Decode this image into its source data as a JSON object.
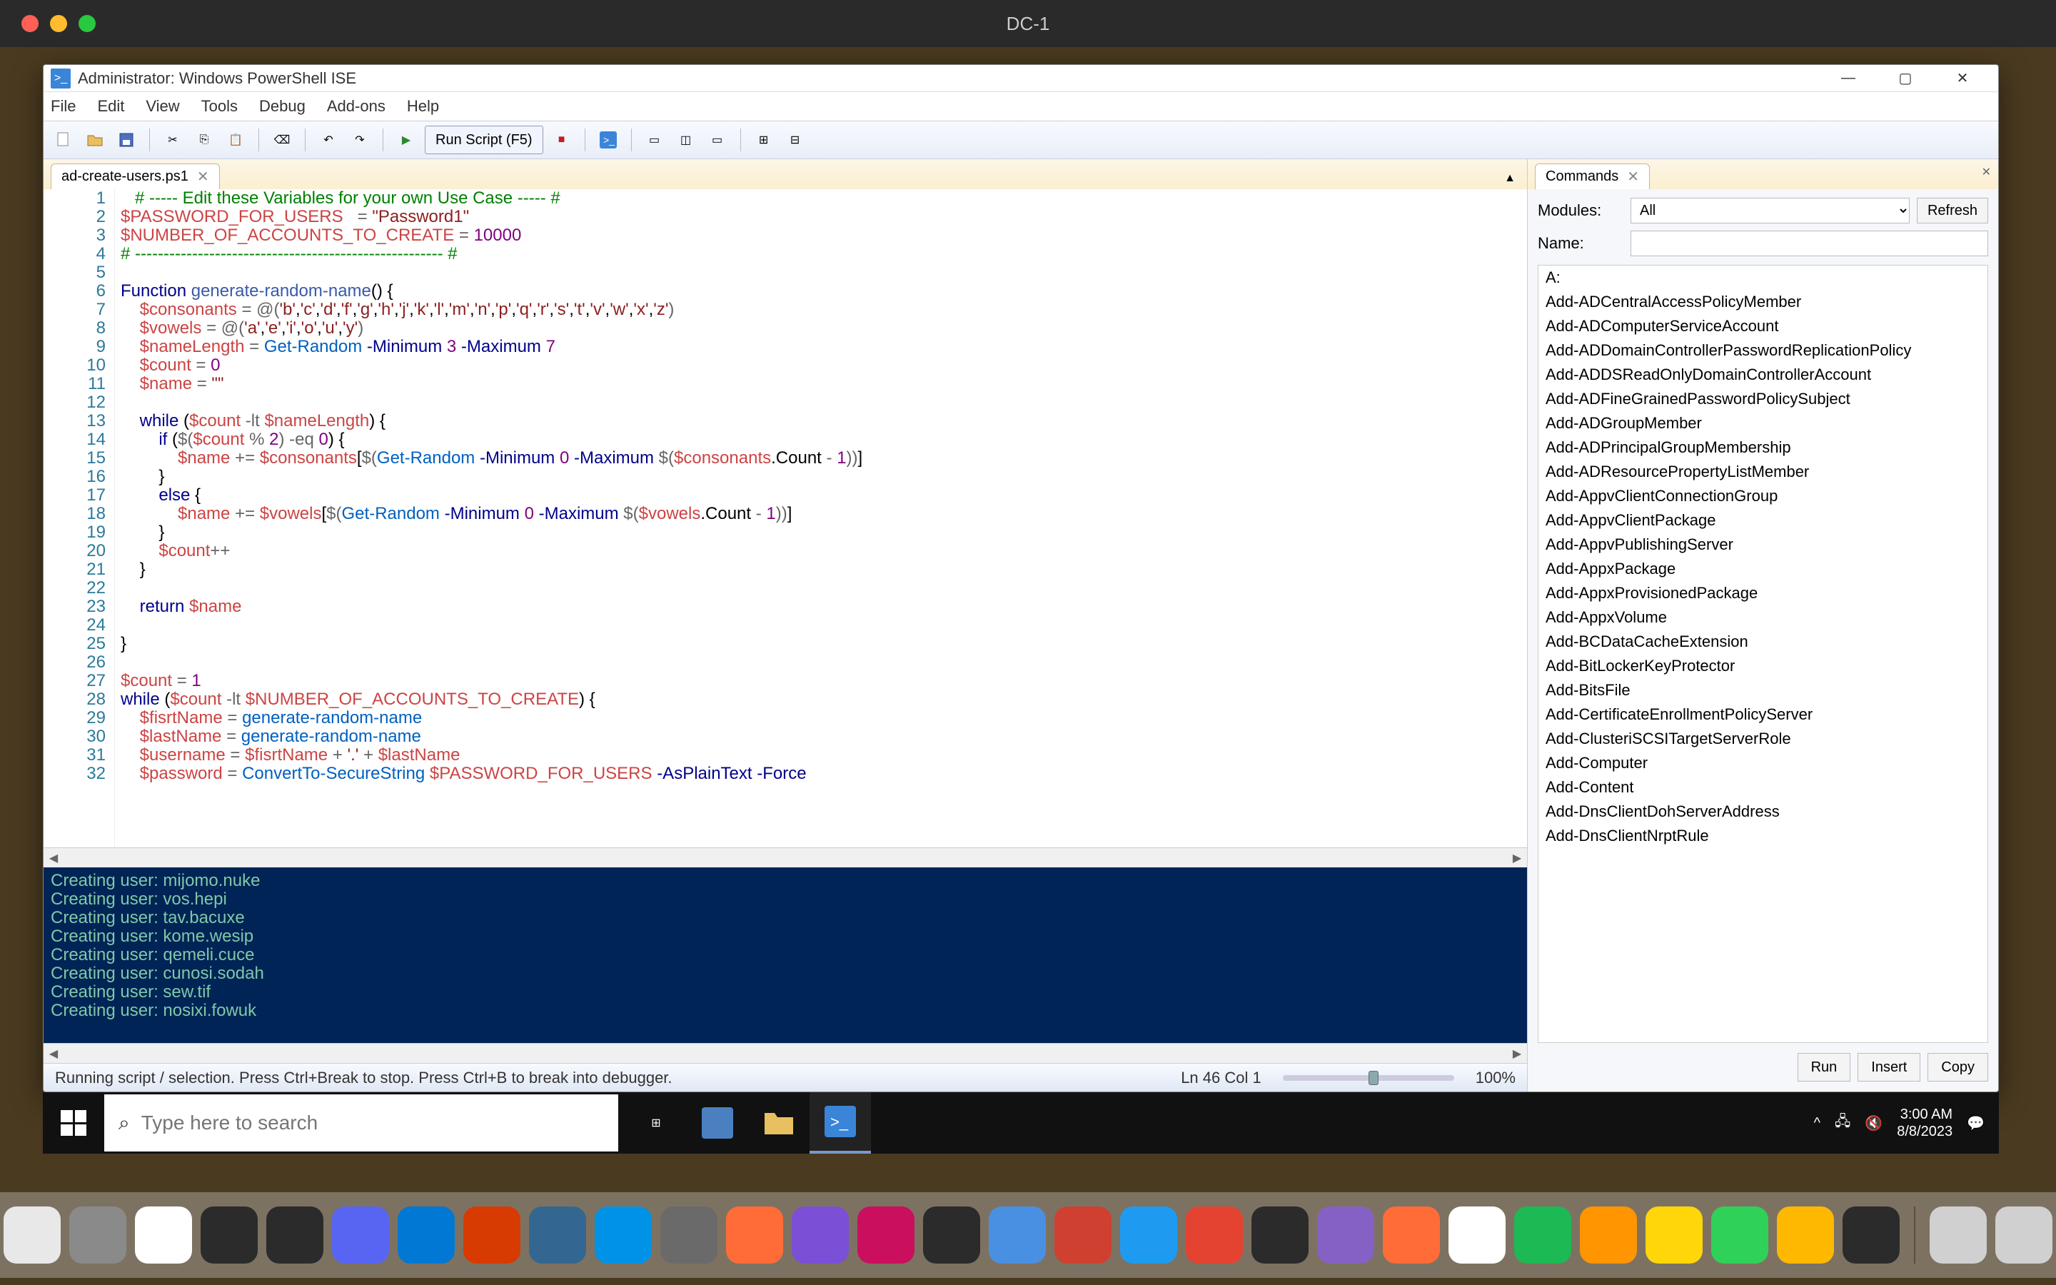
{
  "mac": {
    "window_title": "DC-1",
    "menubar_right": {
      "time": "3:00 AM",
      "date": "8/8/2023"
    }
  },
  "ise": {
    "titlebar": "Administrator: Windows PowerShell ISE",
    "menus": [
      "File",
      "Edit",
      "View",
      "Tools",
      "Debug",
      "Add-ons",
      "Help"
    ],
    "run_button": "Run Script (F5)",
    "tab": {
      "label": "ad-create-users.ps1"
    },
    "status": {
      "left": "Running script / selection.  Press Ctrl+Break to stop.  Press Ctrl+B to break into debugger.",
      "pos": "Ln 46  Col 1",
      "zoom": "100%"
    },
    "code_lines": [
      {
        "n": 1,
        "html": "   <span class='c-comment'># ----- Edit these Variables for your own Use Case ----- #</span>"
      },
      {
        "n": 2,
        "html": "<span class='c-var'>$PASSWORD_FOR_USERS</span>   <span class='c-op'>=</span> <span class='c-string'>\"Password1\"</span>"
      },
      {
        "n": 3,
        "html": "<span class='c-var'>$NUMBER_OF_ACCOUNTS_TO_CREATE</span> <span class='c-op'>=</span> <span class='c-num'>10000</span>"
      },
      {
        "n": 4,
        "html": "<span class='c-comment'># ------------------------------------------------------ #</span>"
      },
      {
        "n": 5,
        "html": ""
      },
      {
        "n": 6,
        "html": "<span class='c-key'>Function</span> <span class='c-func'>generate-random-name</span>() {"
      },
      {
        "n": 7,
        "html": "    <span class='c-var'>$consonants</span> <span class='c-op'>=</span> <span class='c-op'>@(</span><span class='c-string'>'b'</span>,<span class='c-string'>'c'</span>,<span class='c-string'>'d'</span>,<span class='c-string'>'f'</span>,<span class='c-string'>'g'</span>,<span class='c-string'>'h'</span>,<span class='c-string'>'j'</span>,<span class='c-string'>'k'</span>,<span class='c-string'>'l'</span>,<span class='c-string'>'m'</span>,<span class='c-string'>'n'</span>,<span class='c-string'>'p'</span>,<span class='c-string'>'q'</span>,<span class='c-string'>'r'</span>,<span class='c-string'>'s'</span>,<span class='c-string'>'t'</span>,<span class='c-string'>'v'</span>,<span class='c-string'>'w'</span>,<span class='c-string'>'x'</span>,<span class='c-string'>'z'</span><span class='c-op'>)</span>"
      },
      {
        "n": 8,
        "html": "    <span class='c-var'>$vowels</span> <span class='c-op'>=</span> <span class='c-op'>@(</span><span class='c-string'>'a'</span>,<span class='c-string'>'e'</span>,<span class='c-string'>'i'</span>,<span class='c-string'>'o'</span>,<span class='c-string'>'u'</span>,<span class='c-string'>'y'</span><span class='c-op'>)</span>"
      },
      {
        "n": 9,
        "html": "    <span class='c-var'>$nameLength</span> <span class='c-op'>=</span> <span class='c-cmd'>Get-Random</span> <span class='c-key'>-Minimum</span> <span class='c-num'>3</span> <span class='c-key'>-Maximum</span> <span class='c-num'>7</span>"
      },
      {
        "n": 10,
        "html": "    <span class='c-var'>$count</span> <span class='c-op'>=</span> <span class='c-num'>0</span>"
      },
      {
        "n": 11,
        "html": "    <span class='c-var'>$name</span> <span class='c-op'>=</span> <span class='c-string'>\"\"</span>"
      },
      {
        "n": 12,
        "html": ""
      },
      {
        "n": 13,
        "html": "    <span class='c-key'>while</span> (<span class='c-var'>$count</span> <span class='c-op'>-lt</span> <span class='c-var'>$nameLength</span>) {"
      },
      {
        "n": 14,
        "html": "        <span class='c-key'>if</span> (<span class='c-op'>$(</span><span class='c-var'>$count</span> <span class='c-op'>%</span> <span class='c-num'>2</span><span class='c-op'>)</span> <span class='c-op'>-eq</span> <span class='c-num'>0</span>) {"
      },
      {
        "n": 15,
        "html": "            <span class='c-var'>$name</span> <span class='c-op'>+=</span> <span class='c-var'>$consonants</span>[<span class='c-op'>$(</span><span class='c-cmd'>Get-Random</span> <span class='c-key'>-Minimum</span> <span class='c-num'>0</span> <span class='c-key'>-Maximum</span> <span class='c-op'>$(</span><span class='c-var'>$consonants</span>.Count <span class='c-op'>-</span> <span class='c-num'>1</span><span class='c-op'>))</span>]"
      },
      {
        "n": 16,
        "html": "        }"
      },
      {
        "n": 17,
        "html": "        <span class='c-key'>else</span> {"
      },
      {
        "n": 18,
        "html": "            <span class='c-var'>$name</span> <span class='c-op'>+=</span> <span class='c-var'>$vowels</span>[<span class='c-op'>$(</span><span class='c-cmd'>Get-Random</span> <span class='c-key'>-Minimum</span> <span class='c-num'>0</span> <span class='c-key'>-Maximum</span> <span class='c-op'>$(</span><span class='c-var'>$vowels</span>.Count <span class='c-op'>-</span> <span class='c-num'>1</span><span class='c-op'>))</span>]"
      },
      {
        "n": 19,
        "html": "        }"
      },
      {
        "n": 20,
        "html": "        <span class='c-var'>$count</span><span class='c-op'>++</span>"
      },
      {
        "n": 21,
        "html": "    }"
      },
      {
        "n": 22,
        "html": ""
      },
      {
        "n": 23,
        "html": "    <span class='c-key'>return</span> <span class='c-var'>$name</span>"
      },
      {
        "n": 24,
        "html": ""
      },
      {
        "n": 25,
        "html": "}"
      },
      {
        "n": 26,
        "html": ""
      },
      {
        "n": 27,
        "html": "<span class='c-var'>$count</span> <span class='c-op'>=</span> <span class='c-num'>1</span>"
      },
      {
        "n": 28,
        "html": "<span class='c-key'>while</span> (<span class='c-var'>$count</span> <span class='c-op'>-lt</span> <span class='c-var'>$NUMBER_OF_ACCOUNTS_TO_CREATE</span>) {"
      },
      {
        "n": 29,
        "html": "    <span class='c-var'>$fisrtName</span> <span class='c-op'>=</span> <span class='c-cmd'>generate-random-name</span>"
      },
      {
        "n": 30,
        "html": "    <span class='c-var'>$lastName</span> <span class='c-op'>=</span> <span class='c-cmd'>generate-random-name</span>"
      },
      {
        "n": 31,
        "html": "    <span class='c-var'>$username</span> <span class='c-op'>=</span> <span class='c-var'>$fisrtName</span> <span class='c-op'>+</span> <span class='c-string'>'.'</span> <span class='c-op'>+</span> <span class='c-var'>$lastName</span>"
      },
      {
        "n": 32,
        "html": "    <span class='c-var'>$password</span> <span class='c-op'>=</span> <span class='c-cmd'>ConvertTo-SecureString</span> <span class='c-var'>$PASSWORD_FOR_USERS</span> <span class='c-key'>-AsPlainText</span> <span class='c-key'>-Force</span>"
      }
    ],
    "console_lines": [
      "Creating user: mijomo.nuke",
      "Creating user: vos.hepi",
      "Creating user: tav.bacuxe",
      "Creating user: kome.wesip",
      "Creating user: qemeli.cuce",
      "Creating user: cunosi.sodah",
      "Creating user: sew.tif",
      "Creating user: nosixi.fowuk"
    ]
  },
  "commands_panel": {
    "title": "Commands",
    "modules_label": "Modules:",
    "modules_value": "All",
    "name_label": "Name:",
    "refresh": "Refresh",
    "actions": {
      "run": "Run",
      "insert": "Insert",
      "copy": "Copy"
    },
    "list": [
      "A:",
      "Add-ADCentralAccessPolicyMember",
      "Add-ADComputerServiceAccount",
      "Add-ADDomainControllerPasswordReplicationPolicy",
      "Add-ADDSReadOnlyDomainControllerAccount",
      "Add-ADFineGrainedPasswordPolicySubject",
      "Add-ADGroupMember",
      "Add-ADPrincipalGroupMembership",
      "Add-ADResourcePropertyListMember",
      "Add-AppvClientConnectionGroup",
      "Add-AppvClientPackage",
      "Add-AppvPublishingServer",
      "Add-AppxPackage",
      "Add-AppxProvisionedPackage",
      "Add-AppxVolume",
      "Add-BCDataCacheExtension",
      "Add-BitLockerKeyProtector",
      "Add-BitsFile",
      "Add-CertificateEnrollmentPolicyServer",
      "Add-ClusteriSCSITargetServerRole",
      "Add-Computer",
      "Add-Content",
      "Add-DnsClientDohServerAddress",
      "Add-DnsClientNrptRule"
    ]
  },
  "win_taskbar": {
    "search_placeholder": "Type here to search",
    "tray": {
      "time": "3:00 AM",
      "date": "8/8/2023"
    }
  },
  "dock": {
    "icons": [
      {
        "name": "finder",
        "bg": "#1e9bf0"
      },
      {
        "name": "1password",
        "bg": "#e8e8e8"
      },
      {
        "name": "settings",
        "bg": "#8a8a8a"
      },
      {
        "name": "chrome",
        "bg": "#fff"
      },
      {
        "name": "figma",
        "bg": "#2b2b2b"
      },
      {
        "name": "terminal",
        "bg": "#2b2b2b"
      },
      {
        "name": "discord",
        "bg": "#5865f2"
      },
      {
        "name": "vscode",
        "bg": "#0078d4"
      },
      {
        "name": "office",
        "bg": "#d83b01"
      },
      {
        "name": "postgres",
        "bg": "#336791"
      },
      {
        "name": "docker",
        "bg": "#0092e6"
      },
      {
        "name": "mamp",
        "bg": "#6a6a6a"
      },
      {
        "name": "postman",
        "bg": "#ff6c37"
      },
      {
        "name": "phpstorm",
        "bg": "#7b4fd6"
      },
      {
        "name": "rider",
        "bg": "#c90f5e"
      },
      {
        "name": "intellij",
        "bg": "#2b2b2b"
      },
      {
        "name": "rectangle",
        "bg": "#4a90e2"
      },
      {
        "name": "remotedesktop",
        "bg": "#d04030"
      },
      {
        "name": "safari",
        "bg": "#1e9bf0"
      },
      {
        "name": "todoist",
        "bg": "#e44332"
      },
      {
        "name": "obs",
        "bg": "#2b2b2b"
      },
      {
        "name": "visualstudio",
        "bg": "#8661c5"
      },
      {
        "name": "postman2",
        "bg": "#ff6c37"
      },
      {
        "name": "mongodb",
        "bg": "#fff"
      },
      {
        "name": "spotify",
        "bg": "#1db954"
      },
      {
        "name": "notes-orange",
        "bg": "#ff9500"
      },
      {
        "name": "notes",
        "bg": "#ffd60a"
      },
      {
        "name": "messages",
        "bg": "#30d158"
      },
      {
        "name": "appstore",
        "bg": "#ffb800"
      },
      {
        "name": "iterm",
        "bg": "#2b2b2b"
      }
    ],
    "right_icons": [
      {
        "name": "downloads",
        "bg": "#d0d0d0"
      },
      {
        "name": "documents",
        "bg": "#d0d0d0"
      },
      {
        "name": "trash",
        "bg": "#b0b0b0"
      }
    ]
  }
}
